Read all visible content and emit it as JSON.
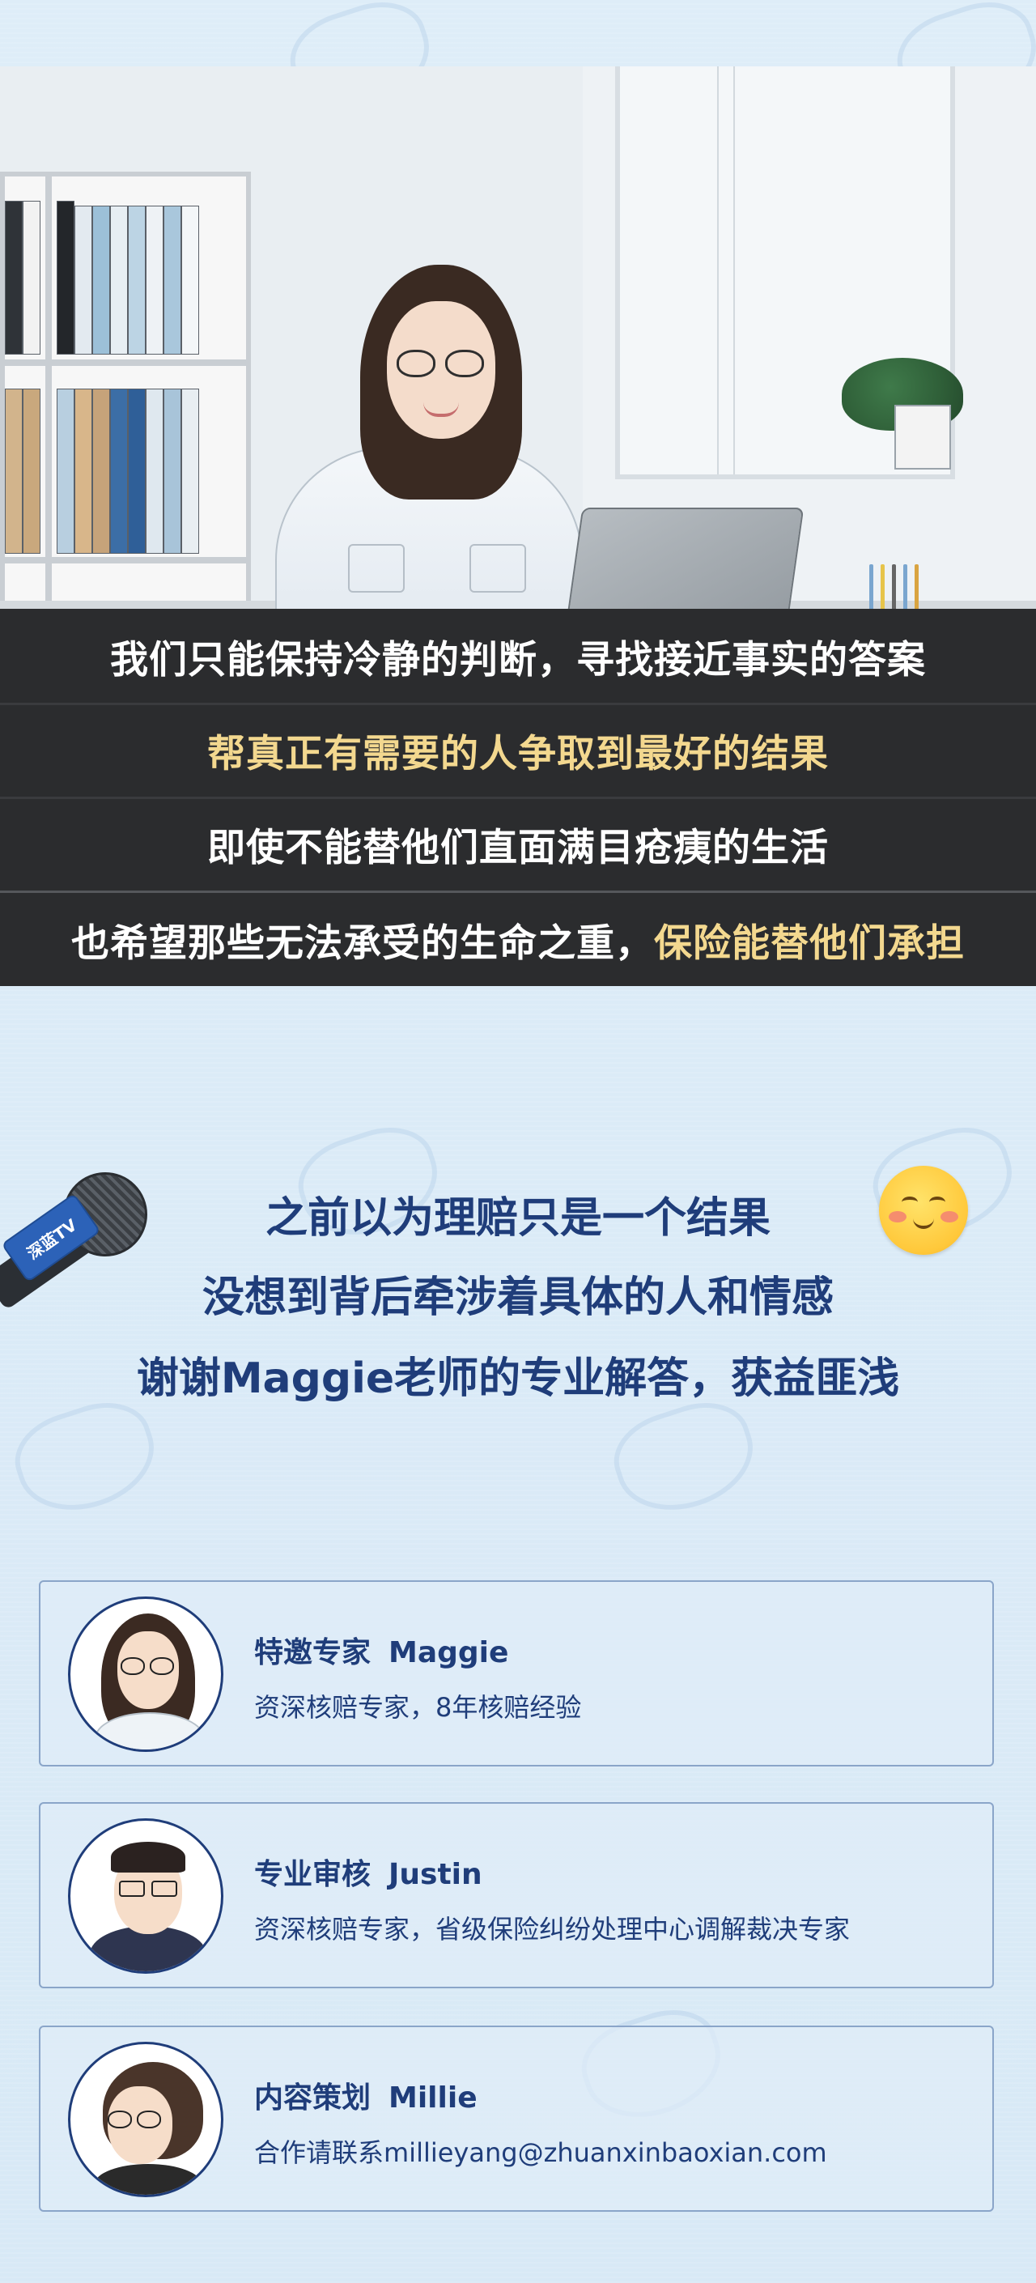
{
  "subtitles": [
    {
      "text": "我们只能保持冷静的判断，寻找接近事实的答案",
      "highlight": ""
    },
    {
      "text": "",
      "highlight": "帮真正有需要的人争取到最好的结果"
    },
    {
      "text": "即使不能替他们直面满目疮痍的生活",
      "highlight": ""
    },
    {
      "text": "也希望那些无法承受的生命之重，",
      "highlight": "保险能替他们承担"
    }
  ],
  "closing": {
    "lines": [
      "之前以为理赔只是一个结果",
      "没想到背后牵涉着具体的人和情感",
      "谢谢Maggie老师的专业解答，获益匪浅"
    ],
    "mic_tag": "深蓝TV"
  },
  "credits": [
    {
      "role": "特邀专家",
      "name": "Maggie",
      "desc": "资深核赔专家，8年核赔经验"
    },
    {
      "role": "专业审核",
      "name": "Justin",
      "desc": "资深核赔专家，省级保险纠纷处理中心调解裁决专家"
    },
    {
      "role": "内容策划",
      "name": "Millie",
      "desc": "合作请联系millieyang@zhuanxinbaoxian.com"
    }
  ],
  "colors": {
    "background": "#dbeaf6",
    "band": "#2b2c2e",
    "highlight": "#f3d88f",
    "navy": "#1f3d7a"
  },
  "icons": {
    "microphone": "microphone-icon",
    "smiley": "smiley-icon",
    "watermark": "shield-logo-icon"
  }
}
